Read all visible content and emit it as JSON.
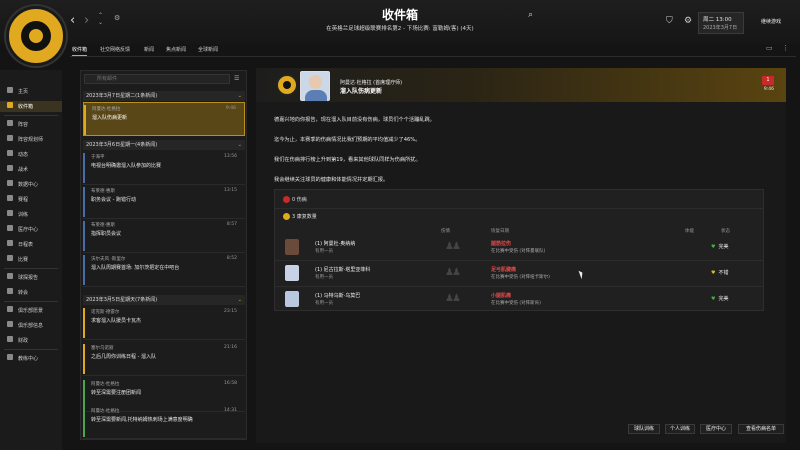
{
  "header": {
    "title": "收件箱",
    "subtitle": "在英格兰足球超级联赛排名第2 - 下场比赛: 富勒姆(客) (4天)",
    "day": "周二 13:00",
    "date": "2023年3月7日",
    "continue_label": "继续游戏"
  },
  "tabs": [
    {
      "label": "收件箱"
    },
    {
      "label": "社交网络反馈"
    },
    {
      "label": "新闻"
    },
    {
      "label": "焦点新闻"
    },
    {
      "label": "全球新闻"
    }
  ],
  "sidebar": {
    "items": [
      {
        "label": "主页"
      },
      {
        "label": "收件箱"
      },
      {
        "label": "阵容"
      },
      {
        "label": "阵容规划师"
      },
      {
        "label": "动态"
      },
      {
        "label": "战术"
      },
      {
        "label": "数据中心"
      },
      {
        "label": "赛程"
      },
      {
        "label": "训练"
      },
      {
        "label": "医疗中心"
      },
      {
        "label": "日程表"
      },
      {
        "label": "比赛"
      },
      {
        "label": "球探报告"
      },
      {
        "label": "转会"
      },
      {
        "label": "俱乐部愿景"
      },
      {
        "label": "俱乐部信息"
      },
      {
        "label": "财政"
      },
      {
        "label": "教练中心"
      }
    ]
  },
  "inbox": {
    "search_placeholder": "所有邮件",
    "groups": [
      {
        "label": "2023年3月7日星期二(1条新闻)"
      },
      {
        "label": "2023年3月6日星期一(4条新闻)"
      },
      {
        "label": "2023年3月5日星期天(7条新闻)"
      }
    ],
    "messages": [
      {
        "sender": "阿曼达·杜格拉",
        "subject": "溜入队伤病更新",
        "time": "9:46",
        "bar": "#e0a920"
      },
      {
        "sender": "于海平",
        "subject": "电视台明确邀溜入队参加的比赛",
        "time": "13:56",
        "bar": "#4a6aa8"
      },
      {
        "sender": "布莱德·惠斯",
        "subject": "职务会议 - 跑错行动",
        "time": "13:15",
        "bar": "#4a6aa8"
      },
      {
        "sender": "布莱德·惠斯",
        "subject": "指挥职员会议",
        "time": "8:57",
        "bar": "#4a6aa8"
      },
      {
        "sender": "沃尔夫风 ·斯里尔",
        "subject": "溜入队周期赛首场: 加尔茨把定在中吧台",
        "time": "8:52",
        "bar": "#4a6aa8"
      },
      {
        "sender": "诺克斯·德雷尔",
        "subject": "求客溜入队援员卡瓦杰",
        "time": "23:15",
        "bar": "#e0a920"
      },
      {
        "sender": "塞尔乌诺丽",
        "subject": "之后几周你训练日程 - 溜入队",
        "time": "21:16",
        "bar": "#e0a920"
      },
      {
        "sender": "阿曼达·杜格拉",
        "subject": "转至深需要注册团新闻",
        "time": "16:58",
        "bar": "#4aa84a"
      },
      {
        "sender": "阿曼达·杜格拉",
        "subject": "转至深需要新闻,托特纳姆热刺场上满意度明确",
        "time": "14:31",
        "bar": "#4aa84a"
      }
    ]
  },
  "message": {
    "sender": "阿曼达·杜格拉 (首席理疗师)",
    "subject": "溜入队伤病更新",
    "badge": "1",
    "time": "9:46",
    "paragraphs": [
      "德嘉兴地向你报告，现在溜入队目前没有伤病，球员们个个活蹦乱跳。",
      "迄今为止，本赛季的伤病情况比我们预期的平均值减少了46%。",
      "我们在伤病排行榜上升到第19，看来其他球队同样为伤病所扰。",
      "我会继续关注球员的健康和体能情况并定期汇报。"
    ],
    "table": {
      "summary_injured": "0 伤病",
      "summary_recovering": "3 康复数量",
      "col_type": "伤情",
      "col_recovery": "恢复日期",
      "col_status": "状态",
      "col_fitness": "体能",
      "players": [
        {
          "name": "(1) 阿曼杜·奥纳纳",
          "position": "有用一员",
          "injury": "腿筋拉伤",
          "injury_color": "#e24a4a",
          "detail": "在比赛中受伤 (对阵曼联队)",
          "status": "完美",
          "status_color": "#4aa84a"
        },
        {
          "name": "(1) 尼古拉斯·塔里亚菲科",
          "position": "有用一员",
          "injury": "足弓肌腱痛",
          "injury_color": "#e24a4a",
          "detail": "在比赛中受伤 (对阵纽卡斯尔)",
          "status": "不错",
          "status_color": "#d4b828"
        },
        {
          "name": "(1) 马特乌斯·乌莫巴",
          "position": "有用一员",
          "injury": "小腿肌痛",
          "injury_color": "#e24a4a",
          "detail": "在比赛中受伤 (对阵斯肯)",
          "status": "完美",
          "status_color": "#4aa84a"
        }
      ]
    }
  },
  "footer_buttons": [
    {
      "label": "球队训练"
    },
    {
      "label": "个人训练"
    },
    {
      "label": "医疗中心"
    },
    {
      "label": "查看伤病名单"
    }
  ]
}
